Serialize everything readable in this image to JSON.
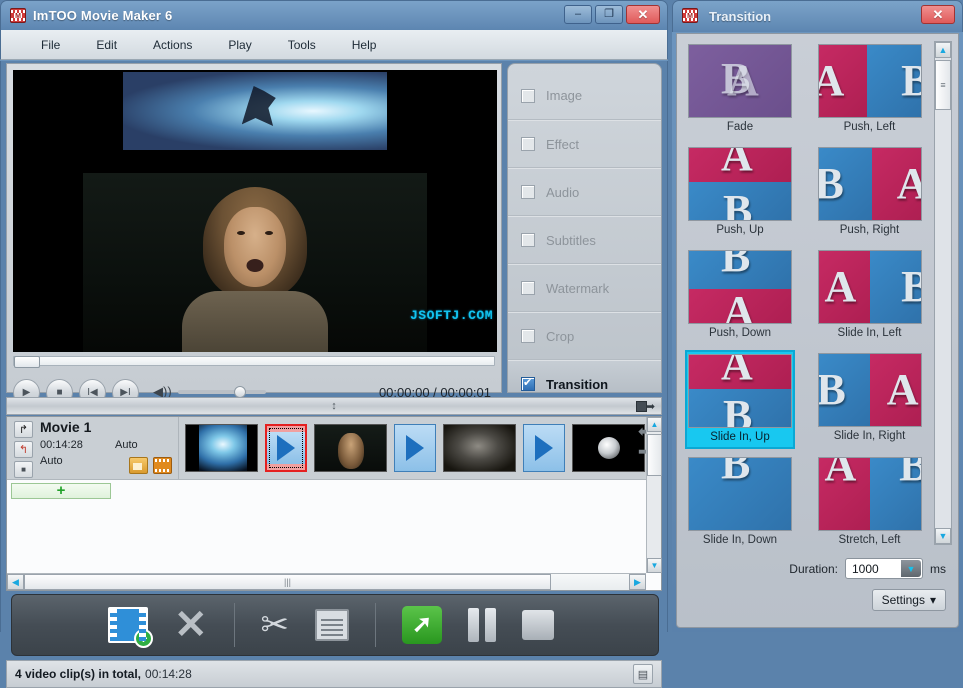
{
  "main_window": {
    "title": "ImTOO Movie Maker 6",
    "app_icon": "film-strip-icon",
    "window_buttons": {
      "minimize": "–",
      "maximize": "❐",
      "close": "✕"
    },
    "menu": [
      "File",
      "Edit",
      "Actions",
      "Play",
      "Tools",
      "Help"
    ]
  },
  "preview": {
    "watermark": "JSOFTJ.COM",
    "time_current": "00:00:00",
    "time_total": "00:00:01",
    "time_display": "00:00:00 / 00:00:01",
    "controls": {
      "play": "▶",
      "stop": "■",
      "previous": "I◀",
      "next": "▶I",
      "volume_icon": "🔊"
    }
  },
  "options": {
    "items": [
      {
        "label": "Image",
        "checked": false,
        "enabled": false
      },
      {
        "label": "Effect",
        "checked": false,
        "enabled": false
      },
      {
        "label": "Audio",
        "checked": false,
        "enabled": false
      },
      {
        "label": "Subtitles",
        "checked": false,
        "enabled": false
      },
      {
        "label": "Watermark",
        "checked": false,
        "enabled": false
      },
      {
        "label": "Crop",
        "checked": false,
        "enabled": false
      },
      {
        "label": "Transition",
        "checked": true,
        "enabled": true
      }
    ]
  },
  "splitter": {
    "grip": "↕"
  },
  "timeline": {
    "movie_name": "Movie 1",
    "duration": "00:14:28",
    "video_mode": "Auto",
    "audio_mode": "Auto",
    "side_buttons": {
      "undo": "↱",
      "redo": "↰",
      "stop": "■"
    },
    "head_icons": {
      "folder": "folder-icon",
      "film": "film-icon"
    },
    "add_strip_label": "+",
    "nav_prev": "⬅",
    "nav_next": "➡",
    "clips": [
      {
        "type": "video",
        "name": "clip-ice"
      },
      {
        "type": "transition",
        "selected": true
      },
      {
        "type": "video",
        "name": "clip-man"
      },
      {
        "type": "transition",
        "selected": false
      },
      {
        "type": "video",
        "name": "clip-smoke"
      },
      {
        "type": "transition",
        "selected": false
      },
      {
        "type": "video",
        "name": "clip-ring"
      }
    ]
  },
  "toolbar": {
    "buttons": [
      {
        "name": "add-video-button",
        "icon": "add-video-icon"
      },
      {
        "name": "remove-button",
        "icon": "cross-icon",
        "glyph": "✕"
      },
      {
        "name": "split-button",
        "icon": "scissors-icon",
        "glyph": "✂"
      },
      {
        "name": "copy-button",
        "icon": "copy-icon"
      },
      {
        "name": "start-button",
        "icon": "start-arrow-icon"
      },
      {
        "name": "pause-button",
        "icon": "pause-icon"
      },
      {
        "name": "stop-button",
        "icon": "stop-icon"
      }
    ]
  },
  "status": {
    "count_text": "4 video clip(s) in total,",
    "total_time": "00:14:28",
    "log_icon": "log-icon"
  },
  "transition_window": {
    "title": "Transition",
    "close_label": "✕",
    "duration_label": "Duration:",
    "duration_value": "1000",
    "duration_unit": "ms",
    "settings_label": "Settings",
    "settings_caret": "▾",
    "scroll": {
      "up": "▲",
      "down": "▼",
      "grip": "≡"
    },
    "transitions": [
      {
        "label": "Fade",
        "style": "fade",
        "selected": false
      },
      {
        "label": "Push, Left",
        "style": "split-v-pink-blue",
        "selected": false
      },
      {
        "label": "Push, Up",
        "style": "split-h-pink-blue",
        "selected": false
      },
      {
        "label": "Push, Right",
        "style": "split-v-blue-pink",
        "selected": false
      },
      {
        "label": "Push, Down",
        "style": "split-h-blue-pink",
        "selected": false
      },
      {
        "label": "Slide In, Left",
        "style": "split-v-pink-blue",
        "selected": false
      },
      {
        "label": "Slide In, Up",
        "style": "split-h-pink-blue",
        "selected": true
      },
      {
        "label": "Slide In, Right",
        "style": "split-v-blue-pink",
        "selected": false
      },
      {
        "label": "Slide In, Down",
        "style": "split-h-blue-pink",
        "selected": false
      },
      {
        "label": "Stretch, Left",
        "style": "split-v-pink-blue",
        "selected": false
      }
    ]
  },
  "colors": {
    "title_blue": "#5d86b1",
    "close_red": "#e05a5a",
    "accent_cyan": "#18c8f0",
    "selection_red": "#e52020",
    "watermark_cyan": "#12c4f0",
    "transition_pink": "#c62a63",
    "transition_blue": "#3a8ac8",
    "start_green": "#2fae43"
  }
}
